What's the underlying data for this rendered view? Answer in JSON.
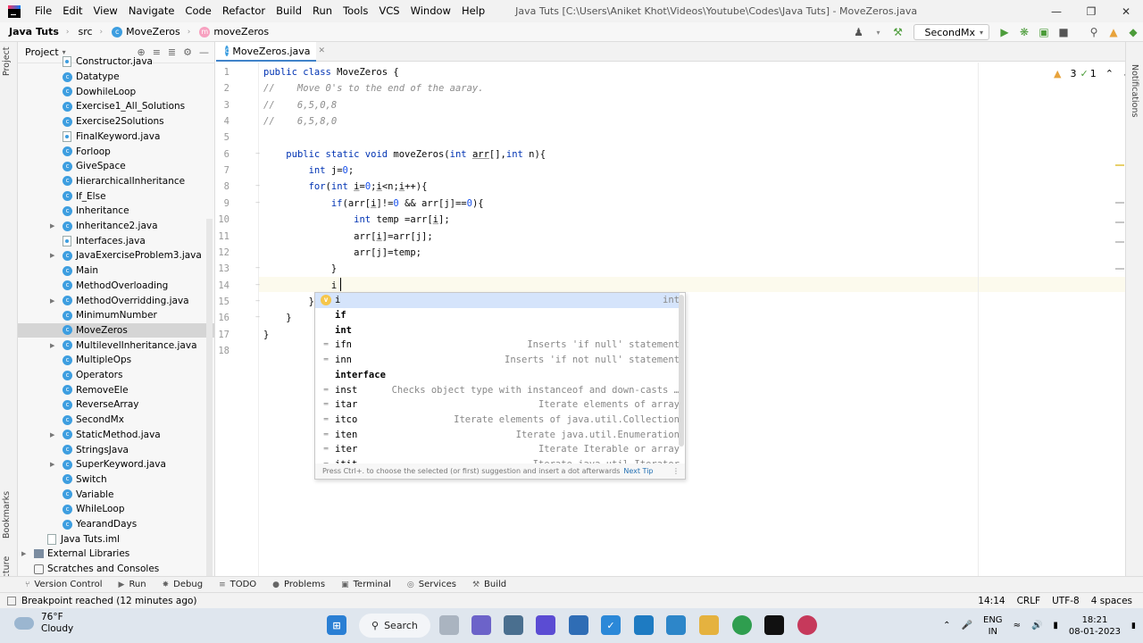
{
  "menu": {
    "items": [
      "File",
      "Edit",
      "View",
      "Navigate",
      "Code",
      "Refactor",
      "Build",
      "Run",
      "Tools",
      "VCS",
      "Window",
      "Help"
    ],
    "window_title": "Java Tuts [C:\\Users\\Aniket Khot\\Videos\\Youtube\\Codes\\Java Tuts] - MoveZeros.java"
  },
  "navbar": {
    "project": "Java Tuts",
    "folder": "src",
    "class": "MoveZeros",
    "method": "moveZeros",
    "run_config": "SecondMx"
  },
  "left_stripe": {
    "project_label": "Project",
    "bookmarks_label": "Bookmarks",
    "structure_label": "Structure"
  },
  "right_stripe": {
    "notifications_label": "Notifications"
  },
  "project_panel": {
    "title": "Project",
    "tree": [
      {
        "label": "Constructor.java",
        "kind": "file",
        "indent": 1
      },
      {
        "label": "Datatype",
        "kind": "class",
        "indent": 1
      },
      {
        "label": "DowhileLoop",
        "kind": "class",
        "indent": 1
      },
      {
        "label": "Exercise1_All_Solutions",
        "kind": "class",
        "indent": 1
      },
      {
        "label": "Exercise2Solutions",
        "kind": "class",
        "indent": 1
      },
      {
        "label": "FinalKeyword.java",
        "kind": "file",
        "indent": 1
      },
      {
        "label": "Forloop",
        "kind": "class",
        "indent": 1
      },
      {
        "label": "GiveSpace",
        "kind": "class",
        "indent": 1
      },
      {
        "label": "HierarchicalInheritance",
        "kind": "class",
        "indent": 1
      },
      {
        "label": "If_Else",
        "kind": "class",
        "indent": 1
      },
      {
        "label": "Inheritance",
        "kind": "class",
        "indent": 1
      },
      {
        "label": "Inheritance2.java",
        "kind": "class",
        "indent": 1,
        "expandable": true
      },
      {
        "label": "Interfaces.java",
        "kind": "file",
        "indent": 1
      },
      {
        "label": "JavaExerciseProblem3.java",
        "kind": "class",
        "indent": 1,
        "expandable": true
      },
      {
        "label": "Main",
        "kind": "class",
        "indent": 1
      },
      {
        "label": "MethodOverloading",
        "kind": "class",
        "indent": 1
      },
      {
        "label": "MethodOverridding.java",
        "kind": "class",
        "indent": 1,
        "expandable": true
      },
      {
        "label": "MinimumNumber",
        "kind": "class",
        "indent": 1
      },
      {
        "label": "MoveZeros",
        "kind": "class",
        "indent": 1,
        "selected": true
      },
      {
        "label": "MultilevelInheritance.java",
        "kind": "class",
        "indent": 1,
        "expandable": true
      },
      {
        "label": "MultipleOps",
        "kind": "class",
        "indent": 1
      },
      {
        "label": "Operators",
        "kind": "class",
        "indent": 1
      },
      {
        "label": "RemoveEle",
        "kind": "class",
        "indent": 1
      },
      {
        "label": "ReverseArray",
        "kind": "class",
        "indent": 1
      },
      {
        "label": "SecondMx",
        "kind": "class",
        "indent": 1
      },
      {
        "label": "StaticMethod.java",
        "kind": "class",
        "indent": 1,
        "expandable": true
      },
      {
        "label": "StringsJava",
        "kind": "class",
        "indent": 1
      },
      {
        "label": "SuperKeyword.java",
        "kind": "class",
        "indent": 1,
        "expandable": true
      },
      {
        "label": "Switch",
        "kind": "class",
        "indent": 1
      },
      {
        "label": "Variable",
        "kind": "class",
        "indent": 1
      },
      {
        "label": "WhileLoop",
        "kind": "class",
        "indent": 1
      },
      {
        "label": "YearandDays",
        "kind": "class",
        "indent": 1
      },
      {
        "label": "Java Tuts.iml",
        "kind": "iml",
        "indent": 0
      },
      {
        "label": "External Libraries",
        "kind": "lib",
        "indent": -1,
        "expandable": true
      },
      {
        "label": "Scratches and Consoles",
        "kind": "scratch",
        "indent": -1
      }
    ]
  },
  "editor": {
    "tab_label": "MoveZeros.java",
    "inspections": {
      "warnings": "3",
      "ok": "1"
    },
    "lines": [
      {
        "n": "1",
        "html": "<span class=\"kw\">public class</span> MoveZeros {"
      },
      {
        "n": "2",
        "html": "<span class=\"cm\">//    Move 0's to the end of the aaray.</span>"
      },
      {
        "n": "3",
        "html": "<span class=\"cm\">//    6,5,0,8</span>"
      },
      {
        "n": "4",
        "html": "<span class=\"cm\">//    6,5,8,0</span>"
      },
      {
        "n": "5",
        "html": ""
      },
      {
        "n": "6",
        "html": "    <span class=\"kw\">public static void</span> moveZeros(<span class=\"kw\">int</span> <span class=\"var\">arr</span>[],<span class=\"kw\">int</span> n){"
      },
      {
        "n": "7",
        "html": "        <span class=\"kw\">int</span> j=<span class=\"num\">0</span>;"
      },
      {
        "n": "8",
        "html": "        <span class=\"kw\">for</span>(<span class=\"kw\">int</span> <span class=\"var\">i</span>=<span class=\"num\">0</span>;<span class=\"var\">i</span>&lt;n;<span class=\"var\">i</span>++){"
      },
      {
        "n": "9",
        "html": "            <span class=\"kw\">if</span>(arr[<span class=\"var\">i</span>]!=<span class=\"num\">0</span> &amp;&amp; arr[j]==<span class=\"num\">0</span>){"
      },
      {
        "n": "10",
        "html": "                <span class=\"kw\">int</span> temp =arr[<span class=\"var\">i</span>];"
      },
      {
        "n": "11",
        "html": "                arr[<span class=\"var\">i</span>]=arr[j];"
      },
      {
        "n": "12",
        "html": "                arr[j]=temp;"
      },
      {
        "n": "13",
        "html": "            }"
      },
      {
        "n": "14",
        "html": "            i"
      },
      {
        "n": "15",
        "html": "        }"
      },
      {
        "n": "16",
        "html": "    }"
      },
      {
        "n": "17",
        "html": "}"
      },
      {
        "n": "18",
        "html": ""
      }
    ]
  },
  "completion": {
    "items": [
      {
        "label": "i",
        "hint": "int",
        "icon": "v",
        "bold": false,
        "selected": true
      },
      {
        "label": "if",
        "hint": "",
        "icon": "",
        "bold": true
      },
      {
        "label": "int",
        "hint": "",
        "icon": "",
        "bold": true
      },
      {
        "label": "ifn",
        "hint": "Inserts 'if null' statement",
        "icon": "t",
        "bold": false
      },
      {
        "label": "inn",
        "hint": "Inserts 'if not null' statement",
        "icon": "t",
        "bold": false
      },
      {
        "label": "interface",
        "hint": "",
        "icon": "",
        "bold": true
      },
      {
        "label": "inst",
        "hint": "Checks object type with instanceof and down-casts …",
        "icon": "t",
        "bold": false
      },
      {
        "label": "itar",
        "hint": "Iterate elements of array",
        "icon": "t",
        "bold": false
      },
      {
        "label": "itco",
        "hint": "Iterate elements of java.util.Collection",
        "icon": "t",
        "bold": false
      },
      {
        "label": "iten",
        "hint": "Iterate java.util.Enumeration",
        "icon": "t",
        "bold": false
      },
      {
        "label": "iter",
        "hint": "Iterate Iterable or array",
        "icon": "t",
        "bold": false
      },
      {
        "label": "itit",
        "hint": "Iterate java.util.Iterator",
        "icon": "t",
        "bold": false
      }
    ],
    "footer": "Press Ctrl+. to choose the selected (or first) suggestion and insert a dot afterwards",
    "footer_link": "Next Tip"
  },
  "bottom_tools": [
    "Version Control",
    "Run",
    "Debug",
    "TODO",
    "Problems",
    "Terminal",
    "Services",
    "Build"
  ],
  "status": {
    "message": "Breakpoint reached (12 minutes ago)",
    "position": "14:14",
    "line_sep": "CRLF",
    "encoding": "UTF-8",
    "indent": "4 spaces"
  },
  "taskbar": {
    "temp": "76°F",
    "weather": "Cloudy",
    "search": "Search",
    "lang1": "ENG",
    "lang2": "IN",
    "time": "18:21",
    "date": "08-01-2023"
  }
}
